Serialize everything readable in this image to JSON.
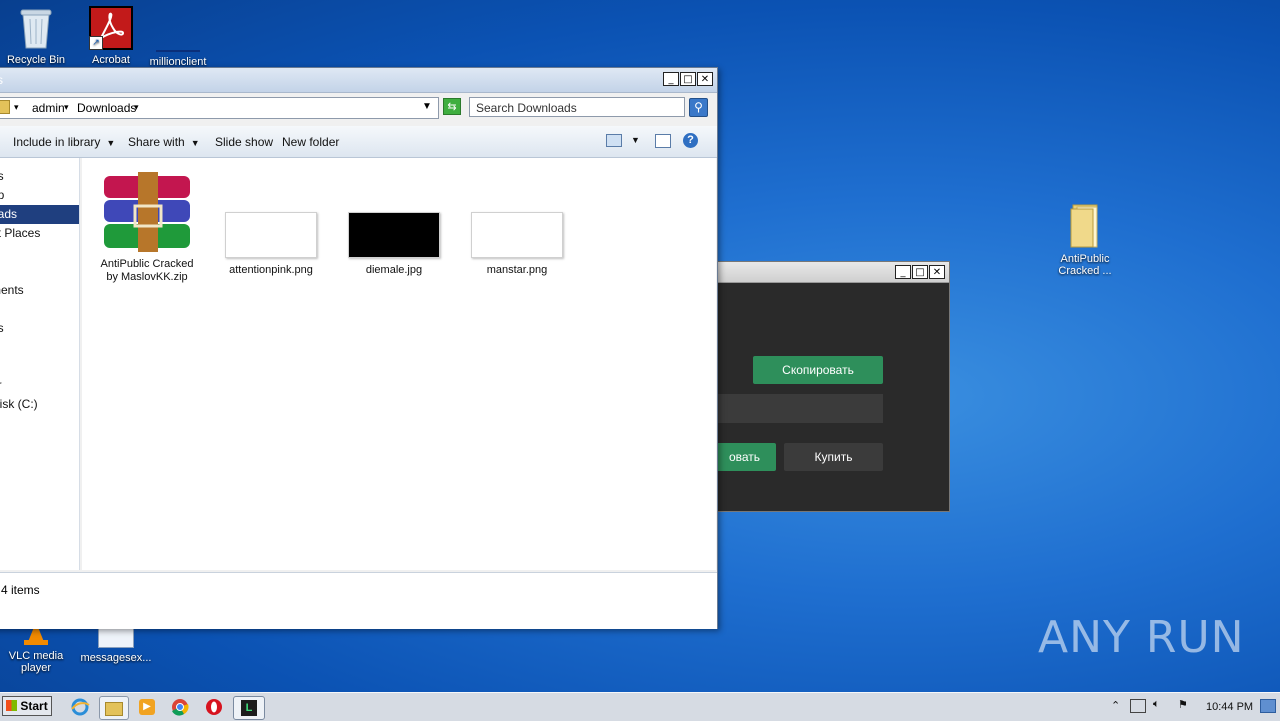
{
  "desktop": {
    "icons": [
      {
        "label": "Recycle Bin"
      },
      {
        "label": "Acrobat"
      },
      {
        "label": "millionclient"
      },
      {
        "label": "AntiPublic Cracked ..."
      },
      {
        "label": "VLC media player"
      },
      {
        "label": "messagesex..."
      }
    ]
  },
  "explorer": {
    "title_fragment": "s",
    "breadcrumb": {
      "part1": "admin",
      "part2": "Downloads"
    },
    "search_placeholder": "Search Downloads",
    "toolbar": {
      "include": "Include in library",
      "share": "Share with",
      "slideshow": "Slide show",
      "newfolder": "New folder"
    },
    "nav": [
      "es",
      "op",
      "oads",
      "nt Places",
      "s",
      "ments",
      "es",
      "s",
      "er",
      "Disk (C:)",
      "k"
    ],
    "files": [
      {
        "name": "AntiPublic Cracked by MaslovKK.zip"
      },
      {
        "name": "attentionpink.png"
      },
      {
        "name": "diemale.jpg"
      },
      {
        "name": "manstar.png"
      }
    ],
    "status": "4 items"
  },
  "app": {
    "copy_button": "Скопировать",
    "activate_button": "овать",
    "buy_button": "Купить",
    "input_value": ""
  },
  "taskbar": {
    "start": "Start",
    "clock": "10:44 PM"
  },
  "watermark": "ANY RUN",
  "colors": {
    "accent_green": "#2e8f5b",
    "dark_bg": "#2a2a2a",
    "nav_selected": "#1f3f7f"
  }
}
